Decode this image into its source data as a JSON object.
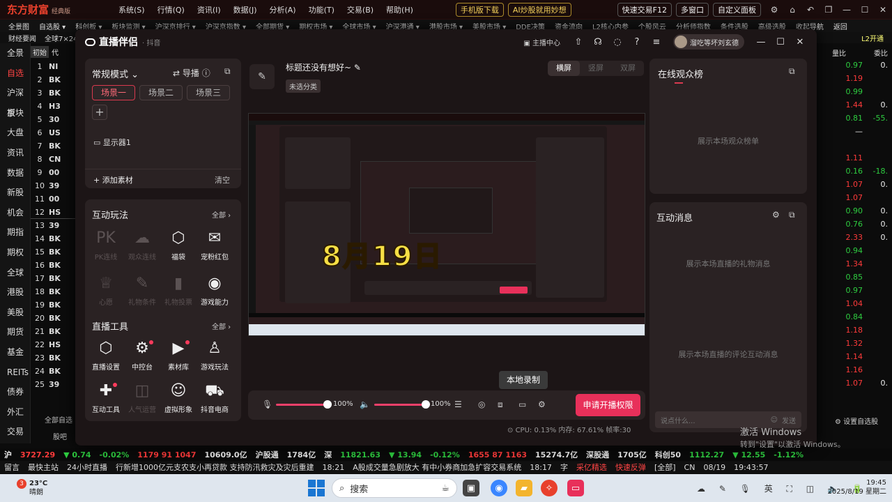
{
  "app": {
    "logo": "东方财富",
    "edition": "经典版",
    "menu": [
      "系统(S)",
      "行情(Q)",
      "资讯(I)",
      "数据(J)",
      "分析(A)",
      "功能(T)",
      "交易(B)",
      "帮助(H)"
    ],
    "pills": [
      "手机版下载",
      "AI炒股就用妙想",
      "快速交易F12",
      "多窗口",
      "自定义面板"
    ],
    "row2": [
      "全景图",
      "自选股 ▾",
      "科创板 ▾",
      "板块监测 ▾",
      "沪深京排行 ▾",
      "沪深京指数 ▾",
      "全部期货 ▾",
      "期权市场 ▾",
      "全球市场 ▾",
      "沪深港通 ▾",
      "港股市场 ▾",
      "美股市场 ▾",
      "DDE决策",
      "资金流向",
      "L2核心内参",
      "个股风云",
      "分析师指数",
      "条件选股",
      "高级选股",
      "收起导航",
      "返回"
    ],
    "row3_left": [
      "财经要闻",
      "全球7×24"
    ],
    "row3_right": "L2开通",
    "leftnav": [
      "全景",
      "自选",
      "沪深京",
      "板块",
      "大盘",
      "资讯",
      "数据",
      "新股",
      "机会",
      "期指",
      "期权",
      "全球",
      "港股",
      "美股",
      "期货",
      "基金",
      "REITs",
      "债券",
      "外汇",
      "交易"
    ],
    "leftnav_active": "自选",
    "stock_header_tab": "初始",
    "stock_header_col": "代",
    "stock_header_right": [
      "量比",
      "委比"
    ],
    "stock_rows": [
      {
        "n": "1",
        "c": "NI"
      },
      {
        "n": "2",
        "c": "BK"
      },
      {
        "n": "3",
        "c": "BK"
      },
      {
        "n": "4",
        "c": "H3"
      },
      {
        "n": "5",
        "c": "30"
      },
      {
        "n": "6",
        "c": "US"
      },
      {
        "n": "7",
        "c": "BK"
      },
      {
        "n": "8",
        "c": "CN"
      },
      {
        "n": "9",
        "c": "00"
      },
      {
        "n": "10",
        "c": "39"
      },
      {
        "n": "11",
        "c": "00"
      },
      {
        "n": "12",
        "c": "HS"
      },
      {
        "n": "13",
        "c": "39"
      },
      {
        "n": "14",
        "c": "BK"
      },
      {
        "n": "15",
        "c": "BK"
      },
      {
        "n": "16",
        "c": "BK"
      },
      {
        "n": "17",
        "c": "BK"
      },
      {
        "n": "18",
        "c": "BK"
      },
      {
        "n": "19",
        "c": "BK"
      },
      {
        "n": "20",
        "c": "BK"
      },
      {
        "n": "21",
        "c": "BK"
      },
      {
        "n": "22",
        "c": "HS"
      },
      {
        "n": "23",
        "c": "BK"
      },
      {
        "n": "24",
        "c": "BK"
      },
      {
        "n": "25",
        "c": "39"
      }
    ],
    "right_rows": [
      {
        "a": "0.97",
        "ac": "green",
        "b": "0."
      },
      {
        "a": "1.19",
        "ac": "red",
        "b": ""
      },
      {
        "a": "0.99",
        "ac": "green",
        "b": ""
      },
      {
        "a": "1.44",
        "ac": "red",
        "b": "0."
      },
      {
        "a": "0.81",
        "ac": "green",
        "b": "-55."
      },
      {
        "a": "—",
        "ac": "white",
        "b": ""
      },
      {
        "a": "",
        "ac": "white",
        "b": ""
      },
      {
        "a": "1.11",
        "ac": "red",
        "b": ""
      },
      {
        "a": "0.16",
        "ac": "green",
        "b": "-18."
      },
      {
        "a": "1.07",
        "ac": "red",
        "b": "0."
      },
      {
        "a": "1.07",
        "ac": "red",
        "b": ""
      },
      {
        "a": "0.90",
        "ac": "green",
        "b": "0."
      },
      {
        "a": "0.76",
        "ac": "green",
        "b": "0."
      },
      {
        "a": "2.33",
        "ac": "red",
        "b": "0."
      },
      {
        "a": "0.94",
        "ac": "green",
        "b": ""
      },
      {
        "a": "1.34",
        "ac": "red",
        "b": ""
      },
      {
        "a": "0.85",
        "ac": "green",
        "b": ""
      },
      {
        "a": "0.97",
        "ac": "green",
        "b": ""
      },
      {
        "a": "1.04",
        "ac": "red",
        "b": ""
      },
      {
        "a": "0.84",
        "ac": "green",
        "b": ""
      },
      {
        "a": "1.18",
        "ac": "red",
        "b": ""
      },
      {
        "a": "1.32",
        "ac": "red",
        "b": ""
      },
      {
        "a": "1.14",
        "ac": "red",
        "b": ""
      },
      {
        "a": "1.16",
        "ac": "red",
        "b": ""
      },
      {
        "a": "1.07",
        "ac": "red",
        "b": "0."
      }
    ],
    "list_footer": "全部自选",
    "list_footer2": "股吧",
    "right_footer": "设置自选股",
    "ticker": [
      {
        "t": "沪",
        "c": "white"
      },
      {
        "t": "3727.29",
        "c": "red"
      },
      {
        "t": "▼ 0.74",
        "c": "green"
      },
      {
        "t": "-0.02%",
        "c": "green"
      },
      {
        "t": "1179 91 1047",
        "c": "red"
      },
      {
        "t": "10609.0亿",
        "c": "white"
      },
      {
        "t": "沪股通",
        "c": "white"
      },
      {
        "t": "1784亿",
        "c": "white"
      },
      {
        "t": "深",
        "c": "white"
      },
      {
        "t": "11821.63",
        "c": "green"
      },
      {
        "t": "▼ 13.94",
        "c": "green"
      },
      {
        "t": "-0.12%",
        "c": "green"
      },
      {
        "t": "1655 87 1163",
        "c": "red"
      },
      {
        "t": "15274.7亿",
        "c": "white"
      },
      {
        "t": "深股通",
        "c": "white"
      },
      {
        "t": "1705亿",
        "c": "white"
      },
      {
        "t": "科创50",
        "c": "white"
      },
      {
        "t": "1112.27",
        "c": "green"
      },
      {
        "t": "▼ 12.55",
        "c": "green"
      },
      {
        "t": "-1.12%",
        "c": "green"
      }
    ],
    "news": [
      "留言",
      "最快主站",
      "24小时直播",
      "行新增1000亿元支农支小再贷款 支持防汛救灾及灾后重建",
      "18:21",
      "A股成交量急剧放大 有中小券商加急扩容交易系统",
      "18:17",
      "字",
      "采亿精选",
      "快速反弹",
      "[全部]",
      "CN",
      "08/19",
      "19:43:57"
    ]
  },
  "modal": {
    "title": "直播伴侣",
    "subtitle": "· 抖音",
    "header_items": [
      "主播中心"
    ],
    "user_name": "溜吃等坏刘玄德",
    "left": {
      "mode": "常规模式",
      "guide": "导播",
      "scenes": [
        "场景一",
        "场景二",
        "场景三"
      ],
      "source": "显示器1",
      "add_material": "添加素材",
      "clear": "清空",
      "interactive_title": "互动玩法",
      "all": "全部",
      "interactive": [
        {
          "label": "PK连线",
          "dim": true,
          "icon": "PK"
        },
        {
          "label": "观众连线",
          "dim": true,
          "icon": "☁"
        },
        {
          "label": "福袋",
          "dim": false,
          "icon": "⬡"
        },
        {
          "label": "宠粉红包",
          "dim": false,
          "icon": "✉"
        },
        {
          "label": "心愿",
          "dim": true,
          "icon": "♕"
        },
        {
          "label": "礼物条件",
          "dim": true,
          "icon": "✎"
        },
        {
          "label": "礼物投票",
          "dim": true,
          "icon": "▮"
        },
        {
          "label": "游戏能力",
          "dim": false,
          "icon": "◉"
        }
      ],
      "tools_title": "直播工具",
      "tools": [
        {
          "label": "直播设置",
          "dim": false,
          "icon": "⬡",
          "dot": false
        },
        {
          "label": "中控台",
          "dim": false,
          "icon": "⚙",
          "dot": true
        },
        {
          "label": "素材库",
          "dim": false,
          "icon": "▶",
          "dot": true
        },
        {
          "label": "游戏玩法",
          "dim": false,
          "icon": "♙",
          "dot": false
        },
        {
          "label": "互动工具",
          "dim": false,
          "icon": "✚",
          "dot": true
        },
        {
          "label": "人气运营",
          "dim": true,
          "icon": "◫",
          "dot": false
        },
        {
          "label": "虚拟形象",
          "dim": false,
          "icon": "☺",
          "dot": false
        },
        {
          "label": "抖音电商",
          "dim": false,
          "icon": "⛟",
          "dot": false
        }
      ]
    },
    "center": {
      "live_title": "标题还没有想好~",
      "category": "未选分类",
      "orientation": [
        "横屏",
        "竖屏",
        "双屏"
      ],
      "overlay_date": "8月19日",
      "mic_volume": "100%",
      "speaker_volume": "100%",
      "mic_level": 1.0,
      "speaker_level": 1.0,
      "tooltip": "本地录制",
      "apply_button": "申请开播权限",
      "stats": "CPU: 0.13%   内存: 67.61%   帧率:30"
    },
    "right": {
      "audience_title": "在线观众榜",
      "audience_empty": "展示本场观众榜单",
      "messages_title": "互动消息",
      "gift_empty": "展示本场直播的礼物消息",
      "comment_empty": "展示本场直播的评论互动消息",
      "input_placeholder": "说点什么...",
      "send": "发送"
    }
  },
  "watermark": {
    "line1": "激活 Windows",
    "line2": "转到\"设置\"以激活 Windows。"
  },
  "taskbar": {
    "temp": "23°C",
    "weather": "晴朗",
    "badge": "3",
    "search_placeholder": "搜索",
    "time": "19:45",
    "date": "2025/8/19 星期二"
  }
}
